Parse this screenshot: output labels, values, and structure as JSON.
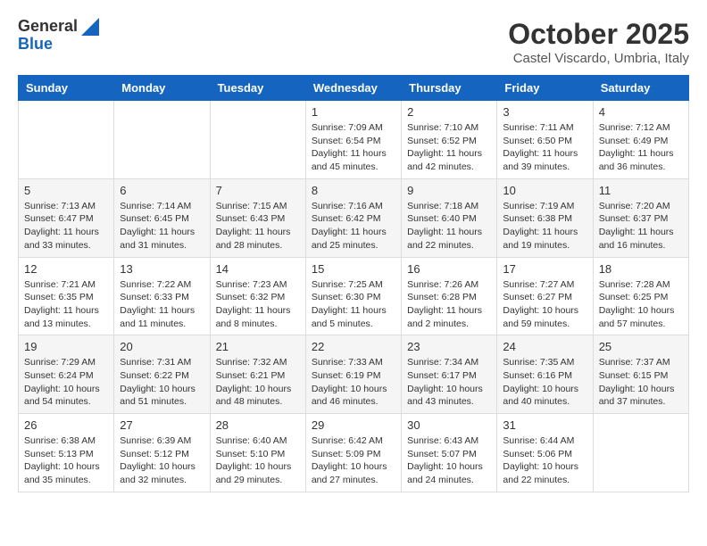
{
  "header": {
    "logo_general": "General",
    "logo_blue": "Blue",
    "month_title": "October 2025",
    "subtitle": "Castel Viscardo, Umbria, Italy"
  },
  "days_of_week": [
    "Sunday",
    "Monday",
    "Tuesday",
    "Wednesday",
    "Thursday",
    "Friday",
    "Saturday"
  ],
  "weeks": [
    {
      "shade": "white",
      "days": [
        {
          "num": "",
          "info": ""
        },
        {
          "num": "",
          "info": ""
        },
        {
          "num": "",
          "info": ""
        },
        {
          "num": "1",
          "info": "Sunrise: 7:09 AM\nSunset: 6:54 PM\nDaylight: 11 hours and 45 minutes."
        },
        {
          "num": "2",
          "info": "Sunrise: 7:10 AM\nSunset: 6:52 PM\nDaylight: 11 hours and 42 minutes."
        },
        {
          "num": "3",
          "info": "Sunrise: 7:11 AM\nSunset: 6:50 PM\nDaylight: 11 hours and 39 minutes."
        },
        {
          "num": "4",
          "info": "Sunrise: 7:12 AM\nSunset: 6:49 PM\nDaylight: 11 hours and 36 minutes."
        }
      ]
    },
    {
      "shade": "shade",
      "days": [
        {
          "num": "5",
          "info": "Sunrise: 7:13 AM\nSunset: 6:47 PM\nDaylight: 11 hours and 33 minutes."
        },
        {
          "num": "6",
          "info": "Sunrise: 7:14 AM\nSunset: 6:45 PM\nDaylight: 11 hours and 31 minutes."
        },
        {
          "num": "7",
          "info": "Sunrise: 7:15 AM\nSunset: 6:43 PM\nDaylight: 11 hours and 28 minutes."
        },
        {
          "num": "8",
          "info": "Sunrise: 7:16 AM\nSunset: 6:42 PM\nDaylight: 11 hours and 25 minutes."
        },
        {
          "num": "9",
          "info": "Sunrise: 7:18 AM\nSunset: 6:40 PM\nDaylight: 11 hours and 22 minutes."
        },
        {
          "num": "10",
          "info": "Sunrise: 7:19 AM\nSunset: 6:38 PM\nDaylight: 11 hours and 19 minutes."
        },
        {
          "num": "11",
          "info": "Sunrise: 7:20 AM\nSunset: 6:37 PM\nDaylight: 11 hours and 16 minutes."
        }
      ]
    },
    {
      "shade": "white",
      "days": [
        {
          "num": "12",
          "info": "Sunrise: 7:21 AM\nSunset: 6:35 PM\nDaylight: 11 hours and 13 minutes."
        },
        {
          "num": "13",
          "info": "Sunrise: 7:22 AM\nSunset: 6:33 PM\nDaylight: 11 hours and 11 minutes."
        },
        {
          "num": "14",
          "info": "Sunrise: 7:23 AM\nSunset: 6:32 PM\nDaylight: 11 hours and 8 minutes."
        },
        {
          "num": "15",
          "info": "Sunrise: 7:25 AM\nSunset: 6:30 PM\nDaylight: 11 hours and 5 minutes."
        },
        {
          "num": "16",
          "info": "Sunrise: 7:26 AM\nSunset: 6:28 PM\nDaylight: 11 hours and 2 minutes."
        },
        {
          "num": "17",
          "info": "Sunrise: 7:27 AM\nSunset: 6:27 PM\nDaylight: 10 hours and 59 minutes."
        },
        {
          "num": "18",
          "info": "Sunrise: 7:28 AM\nSunset: 6:25 PM\nDaylight: 10 hours and 57 minutes."
        }
      ]
    },
    {
      "shade": "shade",
      "days": [
        {
          "num": "19",
          "info": "Sunrise: 7:29 AM\nSunset: 6:24 PM\nDaylight: 10 hours and 54 minutes."
        },
        {
          "num": "20",
          "info": "Sunrise: 7:31 AM\nSunset: 6:22 PM\nDaylight: 10 hours and 51 minutes."
        },
        {
          "num": "21",
          "info": "Sunrise: 7:32 AM\nSunset: 6:21 PM\nDaylight: 10 hours and 48 minutes."
        },
        {
          "num": "22",
          "info": "Sunrise: 7:33 AM\nSunset: 6:19 PM\nDaylight: 10 hours and 46 minutes."
        },
        {
          "num": "23",
          "info": "Sunrise: 7:34 AM\nSunset: 6:17 PM\nDaylight: 10 hours and 43 minutes."
        },
        {
          "num": "24",
          "info": "Sunrise: 7:35 AM\nSunset: 6:16 PM\nDaylight: 10 hours and 40 minutes."
        },
        {
          "num": "25",
          "info": "Sunrise: 7:37 AM\nSunset: 6:15 PM\nDaylight: 10 hours and 37 minutes."
        }
      ]
    },
    {
      "shade": "white",
      "days": [
        {
          "num": "26",
          "info": "Sunrise: 6:38 AM\nSunset: 5:13 PM\nDaylight: 10 hours and 35 minutes."
        },
        {
          "num": "27",
          "info": "Sunrise: 6:39 AM\nSunset: 5:12 PM\nDaylight: 10 hours and 32 minutes."
        },
        {
          "num": "28",
          "info": "Sunrise: 6:40 AM\nSunset: 5:10 PM\nDaylight: 10 hours and 29 minutes."
        },
        {
          "num": "29",
          "info": "Sunrise: 6:42 AM\nSunset: 5:09 PM\nDaylight: 10 hours and 27 minutes."
        },
        {
          "num": "30",
          "info": "Sunrise: 6:43 AM\nSunset: 5:07 PM\nDaylight: 10 hours and 24 minutes."
        },
        {
          "num": "31",
          "info": "Sunrise: 6:44 AM\nSunset: 5:06 PM\nDaylight: 10 hours and 22 minutes."
        },
        {
          "num": "",
          "info": ""
        }
      ]
    }
  ]
}
